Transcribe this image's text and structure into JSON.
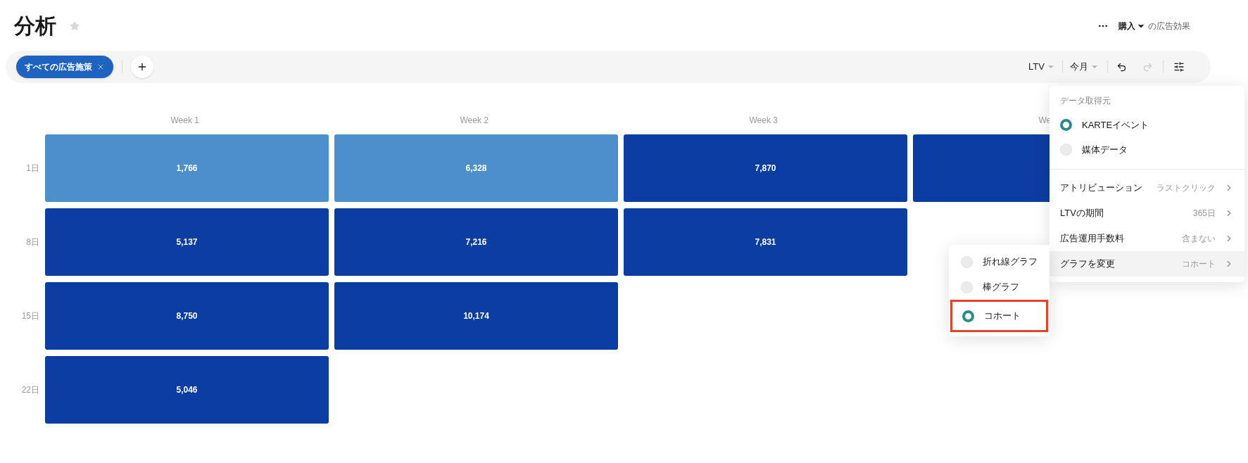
{
  "page": {
    "title": "分析",
    "favorite": false
  },
  "header": {
    "metric": "購入",
    "suffix": "の広告効果"
  },
  "filter_bar": {
    "chips": [
      {
        "label": "すべての広告施策"
      }
    ],
    "metric_dropdown": "LTV",
    "period_dropdown": "今月",
    "redo_disabled": true
  },
  "cohort": {
    "columns": [
      "Week 1",
      "Week 2",
      "Week 3",
      "We"
    ],
    "rows": [
      {
        "label": "1日",
        "cells": [
          {
            "value": "1,766",
            "color": "#4d8ecd"
          },
          {
            "value": "6,328",
            "color": "#4d8ecd"
          },
          {
            "value": "7,870",
            "color": "#0b3da2"
          },
          {
            "color": "#0b3da2"
          }
        ]
      },
      {
        "label": "8日",
        "cells": [
          {
            "value": "5,137",
            "color": "#0b3da2"
          },
          {
            "value": "7,216",
            "color": "#0b3da2"
          },
          {
            "value": "7,831",
            "color": "#0b3da2"
          }
        ]
      },
      {
        "label": "15日",
        "cells": [
          {
            "value": "8,750",
            "color": "#0b3da2"
          },
          {
            "value": "10,174",
            "color": "#0b3da2"
          }
        ]
      },
      {
        "label": "22日",
        "cells": [
          {
            "value": "5,046",
            "color": "#0b3da2"
          }
        ]
      }
    ]
  },
  "settings_menu": {
    "section_title": "データ取得元",
    "sources": [
      {
        "label": "KARTEイベント",
        "selected": true
      },
      {
        "label": "媒体データ",
        "selected": false
      }
    ],
    "options": [
      {
        "label": "アトリビューション",
        "value": "ラストクリック",
        "highlighted": false
      },
      {
        "label": "LTVの期間",
        "value": "365日",
        "highlighted": false
      },
      {
        "label": "広告運用手数料",
        "value": "含まない",
        "highlighted": false
      },
      {
        "label": "グラフを変更",
        "value": "コホート",
        "highlighted": true
      }
    ]
  },
  "chart_type_menu": {
    "items": [
      {
        "label": "折れ線グラフ",
        "selected": false
      },
      {
        "label": "棒グラフ",
        "selected": false
      },
      {
        "label": "コホート",
        "selected": true
      }
    ]
  }
}
